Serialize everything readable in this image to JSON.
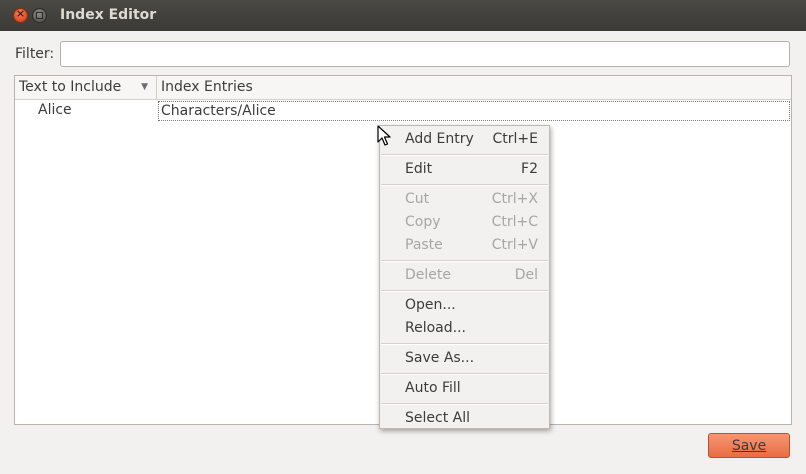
{
  "window": {
    "title": "Index Editor"
  },
  "filter": {
    "label": "Filter:",
    "value": "",
    "placeholder": ""
  },
  "tree": {
    "columns": [
      "Text to Include",
      "Index Entries"
    ],
    "rows": [
      {
        "text": "Alice",
        "entry": "Characters/Alice"
      }
    ]
  },
  "context_menu": {
    "items": [
      {
        "label": "Add Entry",
        "shortcut": "Ctrl+E",
        "enabled": true
      },
      {
        "label": "Edit",
        "shortcut": "F2",
        "enabled": true
      },
      {
        "label": "Cut",
        "shortcut": "Ctrl+X",
        "enabled": false
      },
      {
        "label": "Copy",
        "shortcut": "Ctrl+C",
        "enabled": false
      },
      {
        "label": "Paste",
        "shortcut": "Ctrl+V",
        "enabled": false
      },
      {
        "label": "Delete",
        "shortcut": "Del",
        "enabled": false
      },
      {
        "label": "Open...",
        "shortcut": "",
        "enabled": true
      },
      {
        "label": "Reload...",
        "shortcut": "",
        "enabled": true
      },
      {
        "label": "Save As...",
        "shortcut": "",
        "enabled": true
      },
      {
        "label": "Auto Fill",
        "shortcut": "",
        "enabled": true
      },
      {
        "label": "Select All",
        "shortcut": "",
        "enabled": true
      }
    ]
  },
  "buttons": {
    "save_label": "Save"
  },
  "colors": {
    "title_bar": "#3c3b37",
    "window_bg": "#f2f1f0",
    "accent": "#e96c43"
  },
  "icons": {
    "close": "close-icon",
    "maximize": "maximize-icon",
    "pointer": "mouse-pointer-icon",
    "sort": "sort-arrow-icon"
  }
}
